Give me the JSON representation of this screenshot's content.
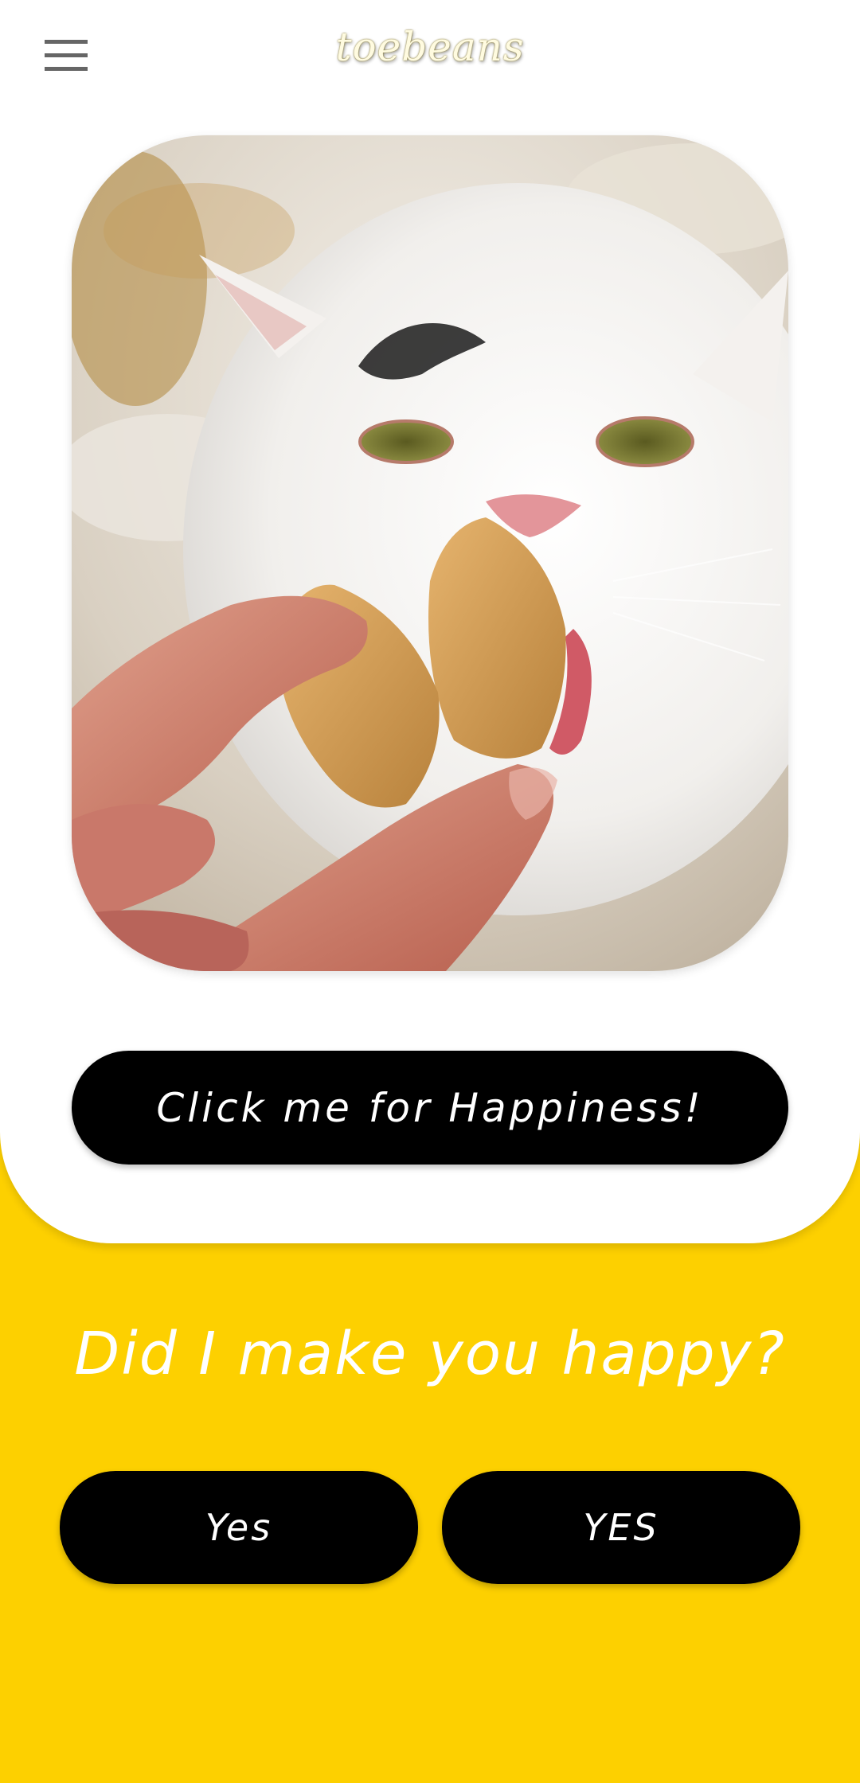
{
  "header": {
    "app_title": "toebeans",
    "menu_icon": "hamburger-menu-icon"
  },
  "photo": {
    "description_icon": "cat-eating-fortune-cookie-photo"
  },
  "main": {
    "happiness_button_label": "Click me for Happiness!",
    "question": "Did I make you happy?",
    "answers": [
      "Yes",
      "YES"
    ]
  },
  "colors": {
    "background_yellow": "#FDD000",
    "card_white": "#FFFFFF",
    "button_black": "#000000",
    "button_text": "#FFFFFF"
  }
}
